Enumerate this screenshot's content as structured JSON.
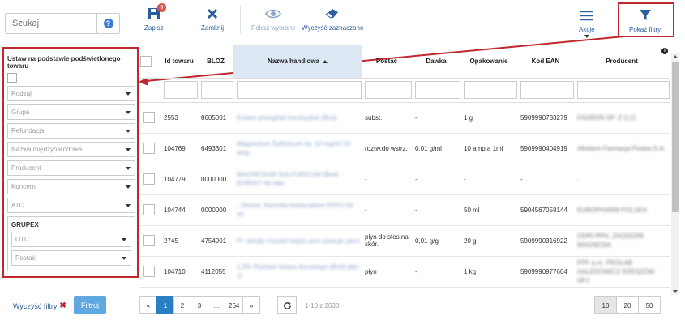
{
  "search": {
    "placeholder": "Szukaj"
  },
  "toolbar": {
    "save_label": "Zapisz",
    "save_badge": "0",
    "close_label": "Zamknij",
    "show_selected_label": "Pokaż wybrane",
    "clear_selected_label": "Wyczyść zaznaczone",
    "actions_label": "Akcje",
    "show_filters_label": "Pokaż filtry"
  },
  "filters": {
    "title": "Ustaw na podstawie podświetlonego towaru",
    "selects": [
      "Rodzaj",
      "Grupa",
      "Refundacja",
      "Nazwa międzynarodowa",
      "Producent",
      "Koncern",
      "ATC"
    ],
    "grupex_title": "GRUPEX",
    "grupex_selects": [
      "OTC",
      "Postać"
    ],
    "clear_label": "Wyczyść filtry",
    "apply_label": "Filtruj"
  },
  "table": {
    "columns": [
      "Id towaru",
      "BLOZ",
      "Nazwa handlowa",
      "Postać",
      "Dawka",
      "Opakowanie",
      "Kod EAN",
      "Producent"
    ],
    "rows": [
      {
        "id": "2553",
        "bloz": "8605001",
        "nazwa": "Kodein phosphat hemihydrat (Bnd)",
        "postac": "subst.",
        "dawka": "-",
        "opakowanie": "1 g",
        "ean": "5909990733279",
        "producent": "FAGRON SP. Z O.O."
      },
      {
        "id": "104769",
        "bloz": "6493301",
        "nazwa": "Magnesium Sulfuricum inj. 10 mg/ml 10 amp.",
        "postac": "roztw.do wstrz.",
        "dawka": "0,01 g/ml",
        "opakowanie": "10 amp.a 1ml",
        "ean": "5909990404919",
        "producent": "Aflofarm Farmacja Polska S.A."
      },
      {
        "id": "104779",
        "bloz": "0000000",
        "nazwa": "MAGNESIUM SULFURICUM (Bnd) EFREKT 60 tabl.",
        "postac": "-",
        "dawka": "-",
        "opakowanie": "-",
        "ean": "-",
        "producent": "-"
      },
      {
        "id": "104744",
        "bloz": "0000000",
        "nazwa": "- Zinemt. Kancela kaseycakeni EFFO 50 ml",
        "postac": "-",
        "dawka": "-",
        "opakowanie": "50 ml",
        "ean": "5904567058144",
        "producent": "EUROPHARM POLSKA"
      },
      {
        "id": "2745",
        "bloz": "4754901",
        "nazwa": "Pr. aksidy meyadi lodytu poro pawuje yami",
        "postac": "płyn do stos.na skór.",
        "dawka": "0,01 g/g",
        "opakowanie": "20 g",
        "ean": "5909990316922",
        "producent": "ODRI PPH. ZAODGRK MAGNESIA"
      },
      {
        "id": "104710",
        "bloz": "4112055",
        "nazwa": "1,3% Roztwór kwasu borowego (Bnd) płyn 1l",
        "postac": "płyn",
        "dawka": "-",
        "opakowanie": "1 kg",
        "ean": "5909990977604",
        "producent": "PPF a.m. PROLAB HALEDOWICZ RZESZÓW SPJ."
      }
    ]
  },
  "pagination": {
    "prev": "«",
    "pages": [
      "1",
      "2",
      "3",
      "...",
      "264"
    ],
    "next": "»",
    "active_page": "1",
    "range_text": "1-10 z 2638",
    "page_sizes": [
      "10",
      "20",
      "50"
    ],
    "active_size": "10"
  },
  "colors": {
    "accent": "#2a7fc4",
    "highlight": "#c0282d",
    "sorted_column": "#dbe7f3"
  }
}
